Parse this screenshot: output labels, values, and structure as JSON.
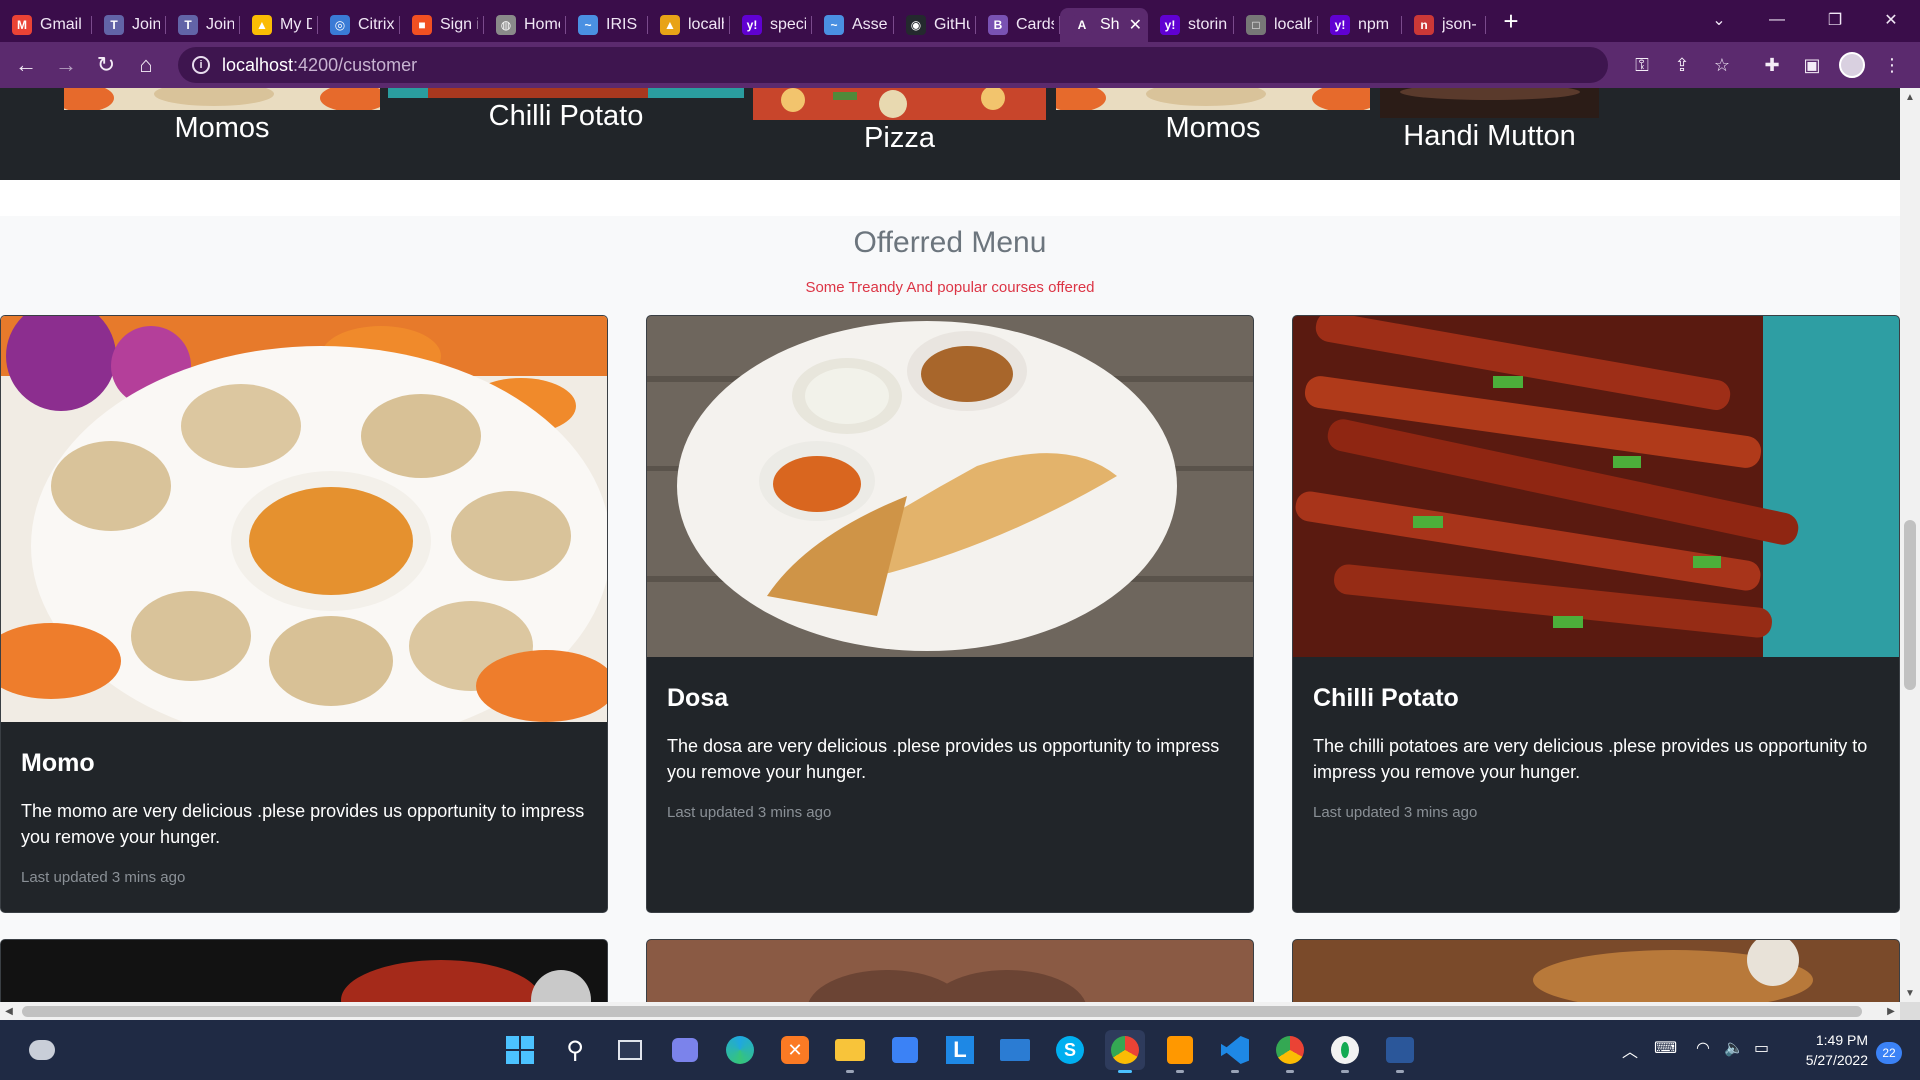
{
  "browser": {
    "tabs": [
      {
        "label": "Gmail",
        "icon": "gmail-icon",
        "color": "#ea4335",
        "glyph": "M"
      },
      {
        "label": "Join c",
        "icon": "teams-icon",
        "color": "#6264a7",
        "glyph": "T"
      },
      {
        "label": "Join c",
        "icon": "teams-icon",
        "color": "#6264a7",
        "glyph": "T"
      },
      {
        "label": "My D",
        "icon": "drive-icon",
        "color": "#fbbc04",
        "glyph": "▲"
      },
      {
        "label": "Citrix",
        "icon": "citrix-icon",
        "color": "#3a7bd5",
        "glyph": "◎"
      },
      {
        "label": "Sign i",
        "icon": "microsoft-icon",
        "color": "#f25022",
        "glyph": "■"
      },
      {
        "label": "Home",
        "icon": "globe-icon",
        "color": "#8a8a8a",
        "glyph": "◍"
      },
      {
        "label": "IRIS |",
        "icon": "iris-icon",
        "color": "#4a90e2",
        "glyph": "~"
      },
      {
        "label": "localh",
        "icon": "localhost-icon",
        "color": "#e8a317",
        "glyph": "▲"
      },
      {
        "label": "specia",
        "icon": "yahoo-icon",
        "color": "#6001d2",
        "glyph": "y!"
      },
      {
        "label": "Asses",
        "icon": "assess-icon",
        "color": "#4a90e2",
        "glyph": "~"
      },
      {
        "label": "GitHu",
        "icon": "github-icon",
        "color": "#24292e",
        "glyph": "◉"
      },
      {
        "label": "Cards",
        "icon": "bootstrap-icon",
        "color": "#7952b3",
        "glyph": "B"
      },
      {
        "label": "Sh",
        "icon": "angular-icon",
        "color": "#5b2a6e",
        "glyph": "A",
        "active": true
      },
      {
        "label": "storin",
        "icon": "yahoo-icon",
        "color": "#6001d2",
        "glyph": "y!"
      },
      {
        "label": "localh",
        "icon": "page-icon",
        "color": "#777777",
        "glyph": "□"
      },
      {
        "label": "npm",
        "icon": "yahoo-icon",
        "color": "#6001d2",
        "glyph": "y!"
      },
      {
        "label": "json-",
        "icon": "npm-icon",
        "color": "#cb3837",
        "glyph": "n"
      }
    ],
    "url_host": "localhost",
    "url_path": ":4200/customer"
  },
  "carousel": {
    "items": [
      {
        "caption": "Momos",
        "color": "#d9822b"
      },
      {
        "caption": "Chilli Potato",
        "color": "#2a9d9f"
      },
      {
        "caption": "Pizza",
        "color": "#c8452b"
      },
      {
        "caption": "Momos",
        "color": "#d9822b"
      },
      {
        "caption": "Handi Mutton",
        "color": "#3b2a24"
      }
    ]
  },
  "menu": {
    "title": "Offerred Menu",
    "subtitle": "Some Treandy And popular courses offered",
    "cards": [
      {
        "title": "Momo",
        "text": "The momo are very delicious .plese provides us opportunity to impress you remove your hunger.",
        "updated": "Last updated 3 mins ago",
        "image": "momo-image"
      },
      {
        "title": "Dosa",
        "text": "The dosa are very delicious .plese provides us opportunity to impress you remove your hunger.",
        "updated": "Last updated 3 mins ago",
        "image": "dosa-image"
      },
      {
        "title": "Chilli Potato",
        "text": "The chilli potatoes are very delicious .plese provides us opportunity to impress you remove your hunger.",
        "updated": "Last updated 3 mins ago",
        "image": "chilli-potato-image"
      }
    ]
  },
  "taskbar": {
    "time": "1:49 PM",
    "date": "5/27/2022",
    "notifications": "22"
  }
}
